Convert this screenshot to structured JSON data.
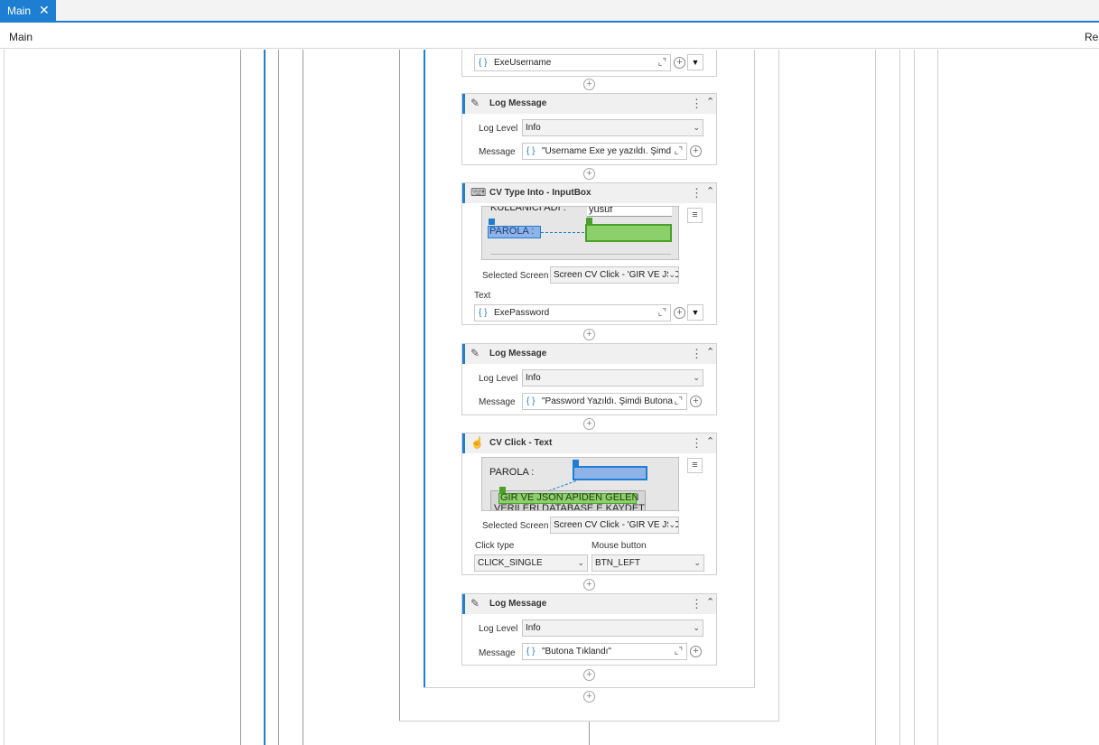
{
  "tab": {
    "label": "Main",
    "close": "✕"
  },
  "breadcrumb": {
    "left": "Main",
    "right": "Res"
  },
  "icons": {
    "close": "close-icon",
    "expand": "expand-icon",
    "add": "plus-circle-icon",
    "dropdown": "triangle-down-icon",
    "menu": "kebab-menu-icon",
    "collapse": "double-chevron-up-icon",
    "hamburger": "hamburger-icon",
    "log": "log-message-icon",
    "typeinto": "cv-type-into-icon",
    "click": "cv-click-icon"
  },
  "top_field": {
    "value": "ExeUsername"
  },
  "log1": {
    "title": "Log Message",
    "level_label": "Log Level",
    "level": "Info",
    "message_label": "Message",
    "message": "\"Username Exe ye yazıldı. Şimd"
  },
  "typeinto": {
    "title": "CV Type Into - InputBox",
    "shot_label1": "KULLANICI ADI :",
    "shot_value1": "yusuf",
    "shot_label2": "PAROLA :",
    "screen_label": "Selected Screen",
    "screen_value": "Screen CV Click - 'GIR VE JSO",
    "text_label": "Text",
    "text_value": "ExePassword"
  },
  "log2": {
    "title": "Log Message",
    "level_label": "Log Level",
    "level": "Info",
    "message_label": "Message",
    "message": "\"Password Yazıldı. Şimdi Butona"
  },
  "click": {
    "title": "CV Click - Text",
    "shot_label": "PAROLA :",
    "shot_button": "GIR VE JSON APIDEN GELEN",
    "shot_button2": "VERILERI DATABASE E KAYDET",
    "screen_label": "Selected Screen",
    "screen_value": "Screen CV Click - 'GIR VE JSO",
    "click_type_label": "Click type",
    "click_type": "CLICK_SINGLE",
    "mouse_button_label": "Mouse button",
    "mouse_button": "BTN_LEFT"
  },
  "log3": {
    "title": "Log Message",
    "level_label": "Log Level",
    "level": "Info",
    "message_label": "Message",
    "message": "\"Butona Tıklandı\""
  },
  "colors": {
    "accent": "#1e7fd2",
    "header_bg": "#f0f0f0",
    "anchor_blue": "#8fb3e8",
    "target_green": "#8ccf6b"
  }
}
